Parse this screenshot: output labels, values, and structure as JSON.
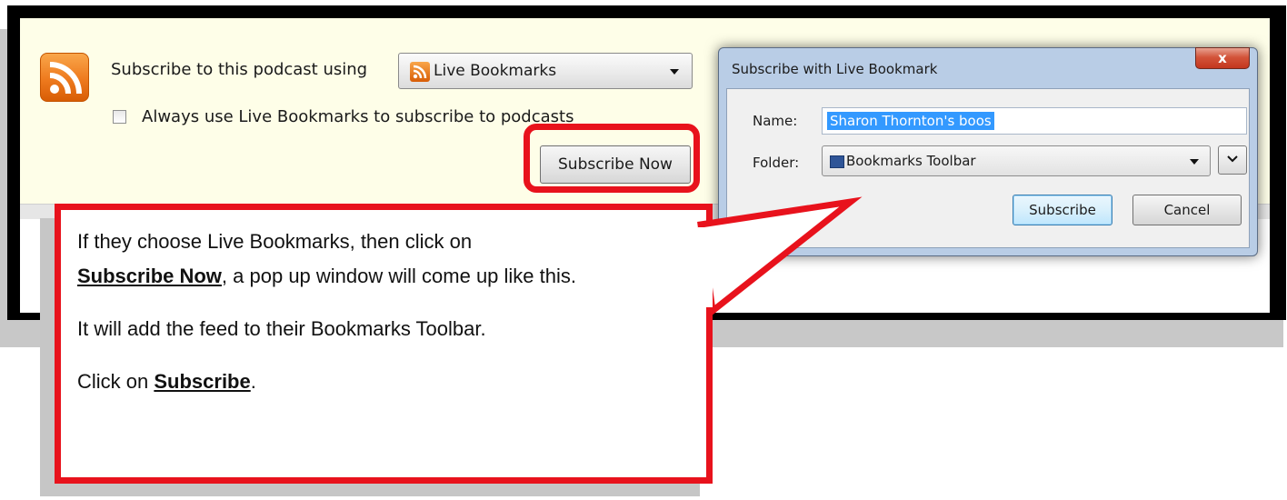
{
  "feedbar": {
    "subscribe_label": "Subscribe to this podcast using",
    "reader_selected": "Live Bookmarks",
    "always_use_label": "Always use Live Bookmarks to subscribe to podcasts",
    "subscribe_now_label": "Subscribe Now"
  },
  "dialog": {
    "title": "Subscribe with Live Bookmark",
    "close_glyph": "x",
    "name_label": "Name:",
    "name_value": "Sharon Thornton's boos",
    "folder_label": "Folder:",
    "folder_selected": "Bookmarks Toolbar",
    "subscribe_label": "Subscribe",
    "cancel_label": "Cancel"
  },
  "callout": {
    "line1_pre": "If they choose Live Bookmarks, then click on",
    "line1_link": "Subscribe Now",
    "line1_post": ", a pop up window will come up like this.",
    "line2": "It will add the feed to their Bookmarks Toolbar.",
    "line3_pre": "Click on ",
    "line3_link": "Subscribe",
    "line3_post": "."
  },
  "colors": {
    "annotation_red": "#e8121c",
    "feedbar_bg": "#fefee8",
    "rss_orange": "#ee7a1e",
    "selection_blue": "#3399ff"
  },
  "icons": {
    "feed": "rss-icon",
    "dropdown": "chevron-down-icon",
    "folder": "bookmarks-folder-icon",
    "close": "close-icon"
  }
}
